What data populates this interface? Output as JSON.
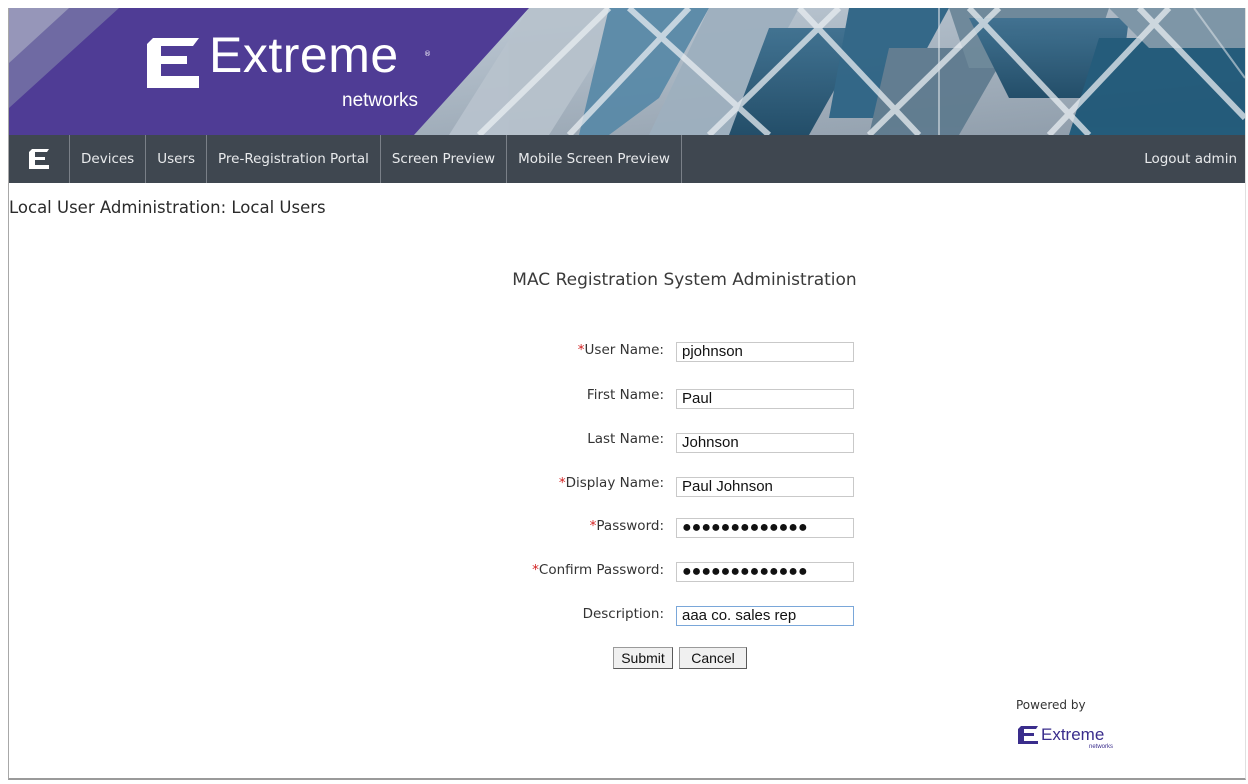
{
  "brand": {
    "name": "Extreme",
    "sub": "networks",
    "tm": "®",
    "purple": "#4f3c95",
    "nav_bg": "#3f4750"
  },
  "nav": {
    "items": [
      {
        "label": "Devices"
      },
      {
        "label": "Users"
      },
      {
        "label": "Pre-Registration Portal"
      },
      {
        "label": "Screen Preview"
      },
      {
        "label": "Mobile Screen Preview"
      }
    ],
    "logout": "Logout admin"
  },
  "page_title": "Local User Administration: Local Users",
  "form": {
    "title": "MAC Registration System Administration",
    "required_mark": "*",
    "fields": [
      {
        "label": "User Name:",
        "required": true,
        "value": "pjohnson"
      },
      {
        "label": "First Name:",
        "required": false,
        "value": "Paul"
      },
      {
        "label": "Last Name:",
        "required": false,
        "value": "Johnson"
      },
      {
        "label": "Display Name:",
        "required": true,
        "value": "Paul Johnson"
      },
      {
        "label": "Password:",
        "required": true,
        "value": "●●●●●●●●●●●●●"
      },
      {
        "label": "Confirm Password:",
        "required": true,
        "value": "●●●●●●●●●●●●●"
      },
      {
        "label": "Description:",
        "required": false,
        "value": "aaa co. sales rep"
      }
    ],
    "submit": "Submit",
    "cancel": "Cancel"
  },
  "footer": {
    "powered_by": "Powered by",
    "brand": "Extreme",
    "brand_sub": "networks"
  }
}
